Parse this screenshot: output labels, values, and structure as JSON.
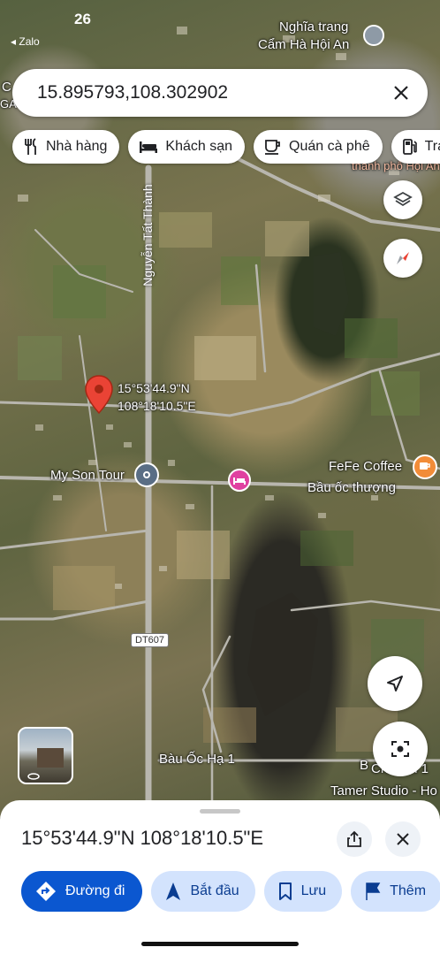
{
  "status_bar": {
    "time": "26",
    "back_app": "◂ Zalo"
  },
  "search": {
    "value": "15.895793,108.302902"
  },
  "chips": [
    {
      "label": "Nhà hàng",
      "icon": "restaurant-icon"
    },
    {
      "label": "Khách sạn",
      "icon": "hotel-icon"
    },
    {
      "label": "Quán cà phê",
      "icon": "coffee-icon"
    },
    {
      "label": "Trạ",
      "icon": "gas-station-icon"
    }
  ],
  "map": {
    "pin_label_line1": "15°53'44.9\"N",
    "pin_label_line2": "108°18'10.5\"E",
    "places": {
      "top_right_line1": "Nghĩa trang",
      "top_right_line2": "Cẩm Hà Hội An",
      "top_left": "C",
      "top_left_2": "GA",
      "city": "thành phố Hội An",
      "my_son_tour": "My Son Tour",
      "fefe_coffee": "FeFe Coffee",
      "bau_oc_thuong": "Bầu ốc thượng",
      "bau_oc_ha": "Bàu Ốc Hạ 1",
      "chem": "Ch...em 1",
      "b_label": "B",
      "tamer": "Tamer Studio - Ho"
    },
    "roads": {
      "nguyen_tat_thanh": "Nguyễn Tất Thành",
      "dt607": "DT607"
    },
    "colors": {
      "pin": "#ea4335",
      "hotel": "#e040a0",
      "coffee": "#f28c38",
      "road_badge": "#ffffff"
    }
  },
  "sheet": {
    "title": "15°53'44.9\"N 108°18'10.5\"E",
    "actions": [
      {
        "label": "Đường đi",
        "icon": "directions-icon"
      },
      {
        "label": "Bắt đầu",
        "icon": "navigation-arrow-icon"
      },
      {
        "label": "Lưu",
        "icon": "bookmark-icon"
      },
      {
        "label": "Thêm",
        "icon": "flag-icon"
      }
    ],
    "accent": "#0b57d0"
  }
}
